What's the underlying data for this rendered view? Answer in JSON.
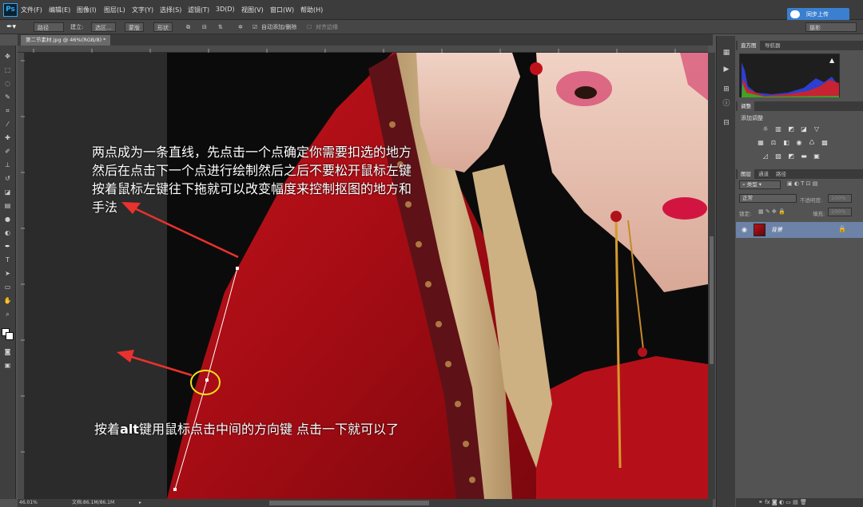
{
  "app": {
    "logo": "Ps"
  },
  "menu": [
    "文件(F)",
    "编辑(E)",
    "图像(I)",
    "图层(L)",
    "文字(Y)",
    "选择(S)",
    "滤镜(T)",
    "3D(D)",
    "视图(V)",
    "窗口(W)",
    "帮助(H)"
  ],
  "cloud_button": {
    "label": "同步上传",
    "icon": "cloud-icon"
  },
  "options": {
    "path_mode": "路径",
    "make_label": "建立:",
    "selection_btn": "选区...",
    "mask_btn": "蒙版",
    "shape_btn": "形状",
    "auto_add_delete": "自动添加/删除",
    "align_edges": "对齐边缘",
    "workspace": "摄影"
  },
  "document": {
    "tab_title": "第二节素材.jpg @ 46%(RGB/8) *"
  },
  "annotations": {
    "paragraph1": [
      "两点成为一条直线，先点击一个点确定你需要扣选的地方",
      "然后在点击下一个点进行绘制然后之后不要松开鼠标左键",
      "按着鼠标左键往下拖就可以改变幅度来控制抠图的地方和",
      "手法"
    ],
    "paragraph2_pre": "按着",
    "paragraph2_key": "alt",
    "paragraph2_post": "键用鼠标点击中间的方向键 点击一下就可以了",
    "arrow_color": "#e8322e",
    "circle_color": "#f2e21a"
  },
  "status": {
    "zoom": "46.01%",
    "doc_size": "文档:86.1M/86.1M"
  },
  "panels": {
    "histogram_tabs": [
      "直方图",
      "导航器"
    ],
    "adjustments_tab": "调整",
    "adjustments_hint": "添加调整",
    "layers_tabs": [
      "图层",
      "通道",
      "路径"
    ],
    "kind_filter": "类型",
    "blend_mode": "正常",
    "opacity_label": "不透明度:",
    "opacity_value": "100%",
    "lock_label": "锁定:",
    "fill_label": "填充:",
    "fill_value": "100%",
    "layer": {
      "name": "背景"
    }
  },
  "tools": [
    "move-tool-icon",
    "marquee-tool-icon",
    "lasso-tool-icon",
    "quick-select-icon",
    "crop-tool-icon",
    "eyedropper-icon",
    "healing-brush-icon",
    "brush-tool-icon",
    "clone-stamp-icon",
    "history-brush-icon",
    "eraser-icon",
    "gradient-icon",
    "blur-icon",
    "dodge-icon",
    "pen-tool-icon",
    "type-tool-icon",
    "path-select-icon",
    "shape-tool-icon",
    "hand-tool-icon",
    "zoom-tool-icon"
  ]
}
